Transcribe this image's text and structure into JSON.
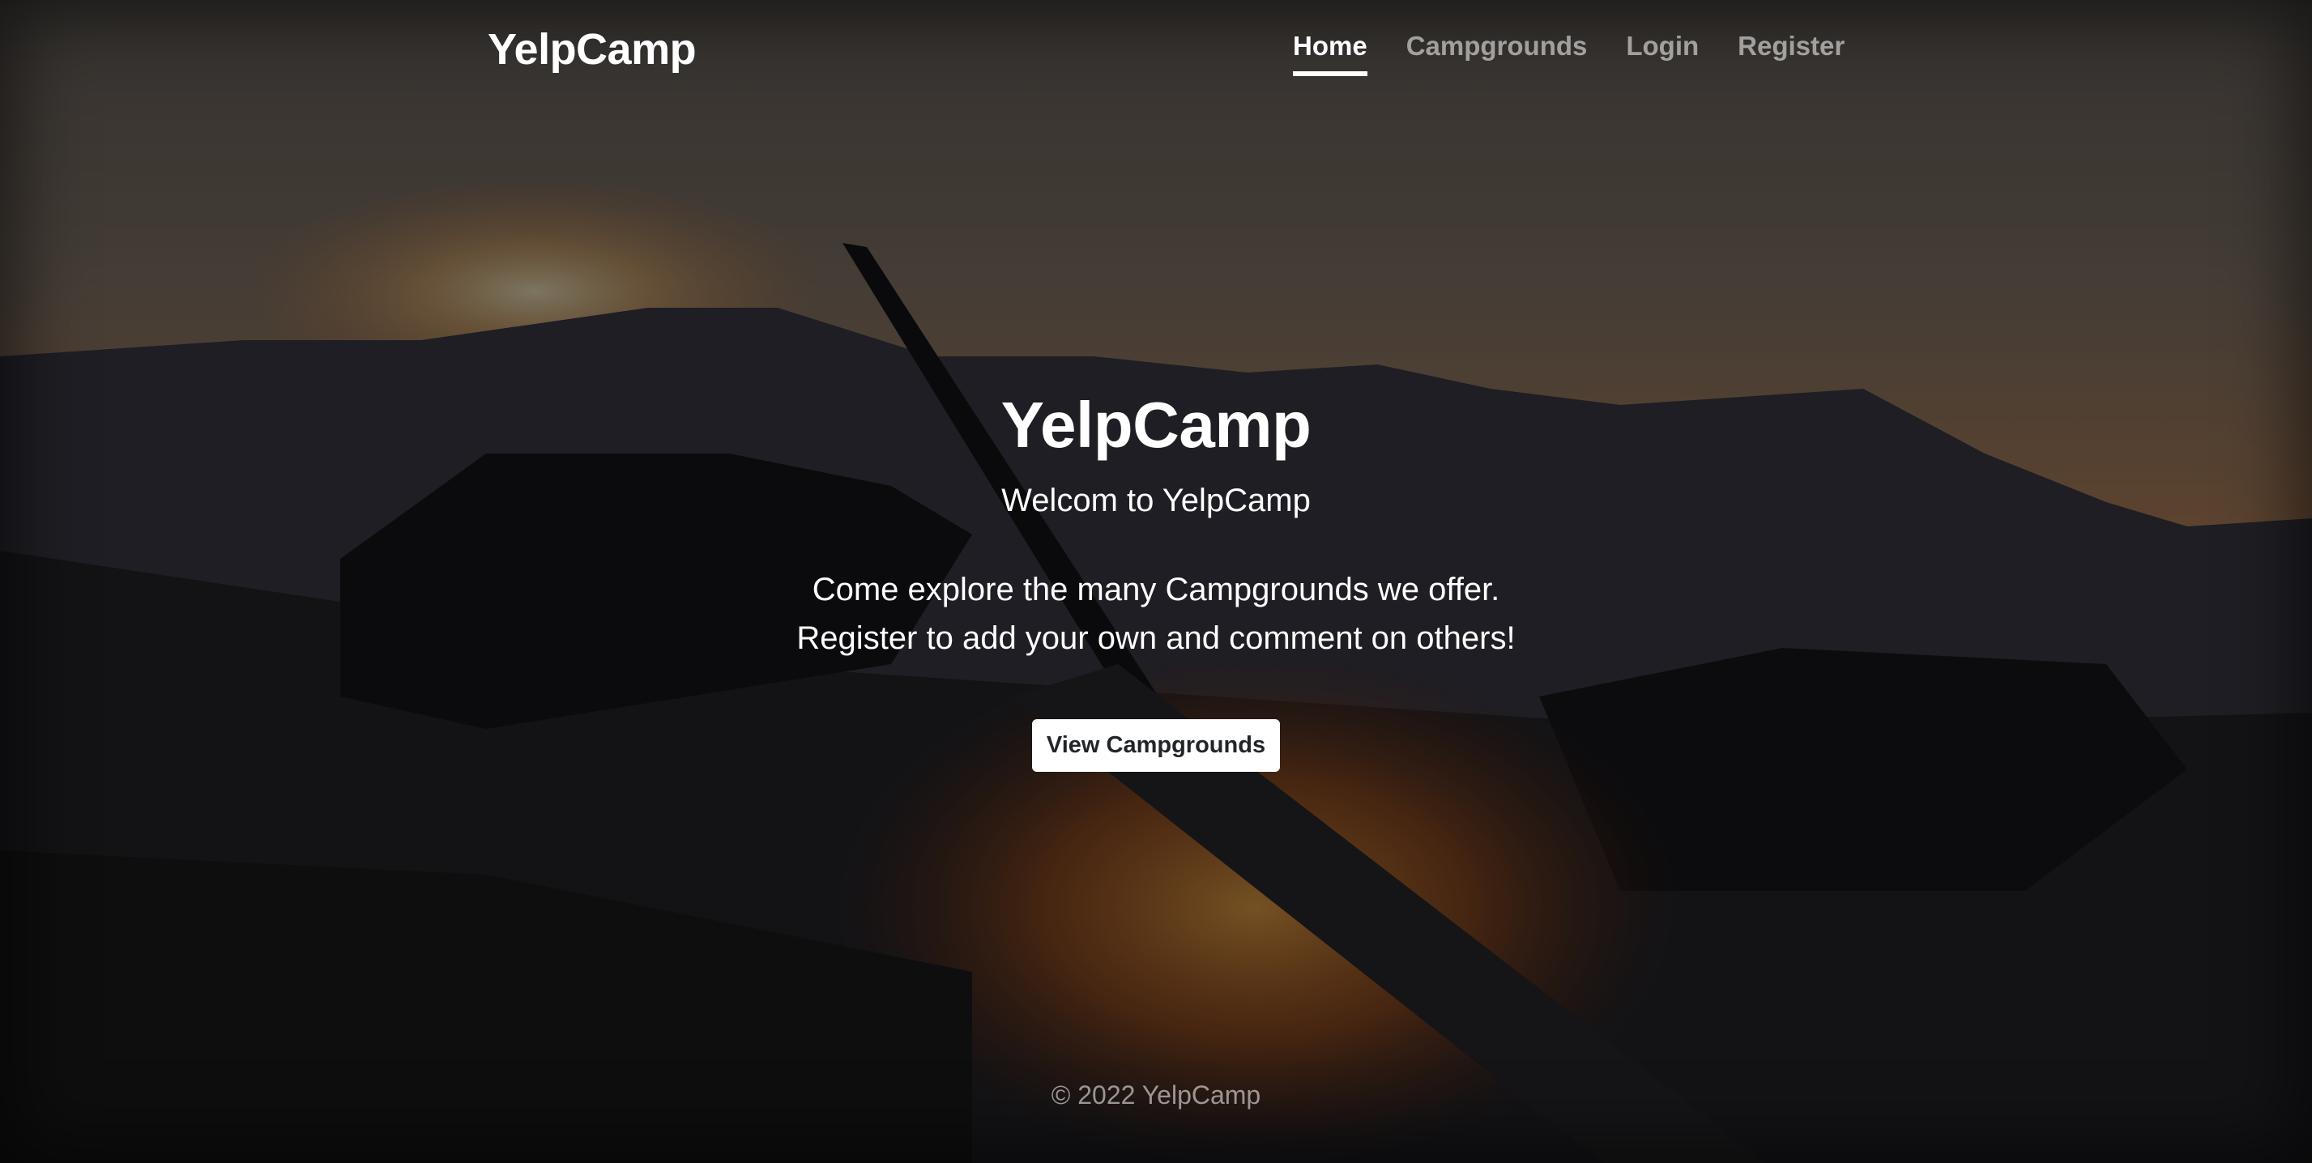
{
  "header": {
    "brand": "YelpCamp",
    "nav": [
      {
        "label": "Home",
        "active": true
      },
      {
        "label": "Campgrounds",
        "active": false
      },
      {
        "label": "Login",
        "active": false
      },
      {
        "label": "Register",
        "active": false
      }
    ]
  },
  "main": {
    "title": "YelpCamp",
    "subtitle": "Welcom to YelpCamp",
    "description_line1": "Come explore the many Campgrounds we offer.",
    "description_line2": "Register to add your own and comment on others!",
    "cta_label": "View Campgrounds"
  },
  "footer": {
    "text": "© 2022 YelpCamp"
  },
  "colors": {
    "overlay": "#000000",
    "text": "#ffffff",
    "muted_text": "#8c8c8c",
    "button_bg": "#ffffff",
    "button_text": "#212529"
  }
}
